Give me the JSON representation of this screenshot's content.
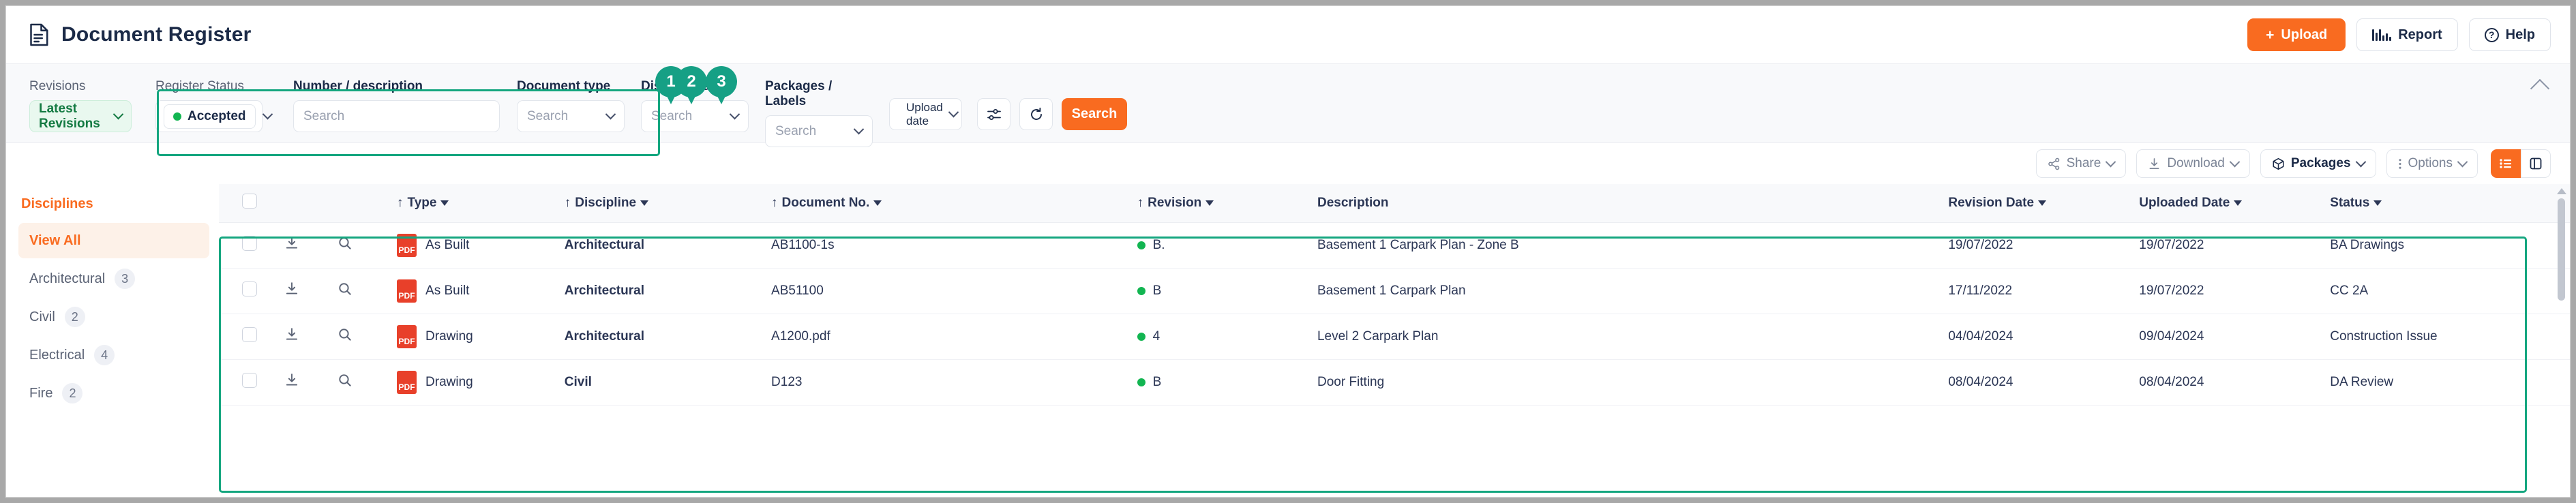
{
  "header": {
    "title": "Document Register",
    "doc_icon": "document-icon",
    "upload_label": "Upload",
    "upload_plus": "+",
    "report_label": "Report",
    "help_label": "Help",
    "help_icon": "question-circle-icon",
    "accent_orange": "#f96b20",
    "title_color": "#1b2a47"
  },
  "filters": {
    "revisions": {
      "label": "Revisions",
      "value": "Latest Revisions"
    },
    "register_status": {
      "label": "Register Status",
      "value": "Accepted",
      "dot_color": "#12b551"
    },
    "number_description": {
      "label": "Number / description",
      "placeholder": "Search",
      "value": ""
    },
    "document_type": {
      "label": "Document type",
      "placeholder": "Search",
      "value": ""
    },
    "disciplines": {
      "label": "Disciplines",
      "placeholder": "Search",
      "value": ""
    },
    "packages_labels": {
      "label": "Packages / Labels",
      "placeholder": "Search",
      "value": ""
    },
    "upload_date": {
      "label": "Upload date",
      "icon": "calendar-plus-icon"
    },
    "settings_icon": "sliders-icon",
    "reset_icon": "refresh-icon",
    "search_button": "Search",
    "pins": [
      "1",
      "2",
      "3"
    ],
    "highlight_color": "#14a67f",
    "pin_color": "#16a085"
  },
  "toolbar": {
    "share": "Share",
    "download": "Download",
    "packages": "Packages",
    "options": "Options",
    "share_icon": "share-icon",
    "download_icon": "download-icon",
    "packages_icon": "box-icon",
    "options_icon": "kebab-menu-icon",
    "view_list_icon": "list-view-icon",
    "view_split_icon": "split-view-icon"
  },
  "sidebar": {
    "title": "Disciplines",
    "items": [
      {
        "label": "View All",
        "count": "",
        "active": true
      },
      {
        "label": "Architectural",
        "count": "3",
        "active": false
      },
      {
        "label": "Civil",
        "count": "2",
        "active": false
      },
      {
        "label": "Electrical",
        "count": "4",
        "active": false
      },
      {
        "label": "Fire",
        "count": "2",
        "active": false
      }
    ]
  },
  "table": {
    "columns": [
      {
        "key": "check",
        "label": "",
        "sortable": false
      },
      {
        "key": "dl",
        "label": "",
        "sortable": false
      },
      {
        "key": "preview",
        "label": "",
        "sortable": false
      },
      {
        "key": "type",
        "label": "Type",
        "sortable": true
      },
      {
        "key": "discipline",
        "label": "Discipline",
        "sortable": true
      },
      {
        "key": "document_no",
        "label": "Document No.",
        "sortable": true
      },
      {
        "key": "revision",
        "label": "Revision",
        "sortable": true
      },
      {
        "key": "description",
        "label": "Description",
        "sortable": false
      },
      {
        "key": "revision_date",
        "label": "Revision Date",
        "sortable": false
      },
      {
        "key": "uploaded_date",
        "label": "Uploaded Date",
        "sortable": false
      },
      {
        "key": "status",
        "label": "Status",
        "sortable": false
      }
    ],
    "rows": [
      {
        "type": "As Built",
        "file_badge": "PDF",
        "discipline": "Architectural",
        "document_no": "AB1100-1s",
        "revision": "B.",
        "revision_dot": "#12b551",
        "description": "Basement 1 Carpark Plan - Zone B",
        "revision_date": "19/07/2022",
        "uploaded_date": "19/07/2022",
        "status": "BA Drawings"
      },
      {
        "type": "As Built",
        "file_badge": "PDF",
        "discipline": "Architectural",
        "document_no": "AB51100",
        "revision": "B",
        "revision_dot": "#12b551",
        "description": "Basement 1 Carpark Plan",
        "revision_date": "17/11/2022",
        "uploaded_date": "19/07/2022",
        "status": "CC 2A"
      },
      {
        "type": "Drawing",
        "file_badge": "PDF",
        "discipline": "Architectural",
        "document_no": "A1200.pdf",
        "revision": "4",
        "revision_dot": "#12b551",
        "description": "Level 2 Carpark Plan",
        "revision_date": "04/04/2024",
        "uploaded_date": "09/04/2024",
        "status": "Construction Issue"
      },
      {
        "type": "Drawing",
        "file_badge": "PDF",
        "discipline": "Civil",
        "document_no": "D123",
        "revision": "B",
        "revision_dot": "#12b551",
        "description": "Door Fitting",
        "revision_date": "08/04/2024",
        "uploaded_date": "08/04/2024",
        "status": "DA Review"
      }
    ],
    "row_icons": {
      "download": "download-row-icon",
      "preview": "magnifier-icon"
    }
  }
}
